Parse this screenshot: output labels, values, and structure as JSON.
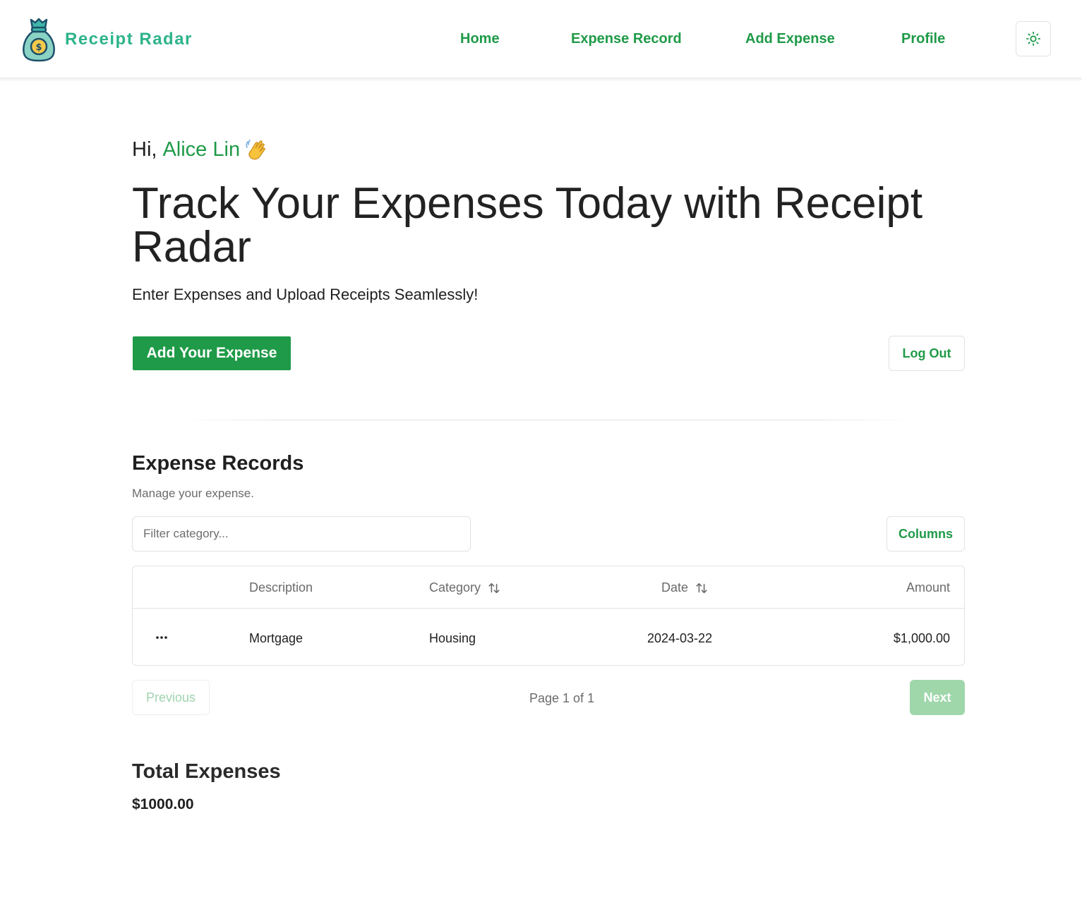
{
  "brand": {
    "name": "Receipt Radar"
  },
  "nav": {
    "links": [
      "Home",
      "Expense Record",
      "Add Expense",
      "Profile"
    ],
    "theme_icon": "sun-icon"
  },
  "hero": {
    "greeting_prefix": "Hi,",
    "user_name": "Alice Lin",
    "wave_icon": "waving-hand-icon",
    "title": "Track Your Expenses Today with Receipt Radar",
    "subtitle": "Enter Expenses and Upload Receipts Seamlessly!",
    "primary_button": "Add Your Expense",
    "logout_button": "Log Out"
  },
  "records": {
    "title": "Expense Records",
    "subtitle": "Manage your expense.",
    "filter_placeholder": "Filter category...",
    "columns_button": "Columns",
    "headers": [
      "Description",
      "Category",
      "Date",
      "Amount"
    ],
    "rows": [
      {
        "description": "Mortgage",
        "category": "Housing",
        "date": "2024-03-22",
        "amount": "$1,000.00"
      }
    ],
    "pagination": {
      "previous": "Previous",
      "page_info": "Page 1 of 1",
      "next": "Next"
    }
  },
  "totals": {
    "title": "Total Expenses",
    "value": "$1000.00"
  },
  "colors": {
    "accent": "#1f9a48",
    "brand_text": "#2db38a",
    "disabled_button": "#9fd7ab"
  }
}
